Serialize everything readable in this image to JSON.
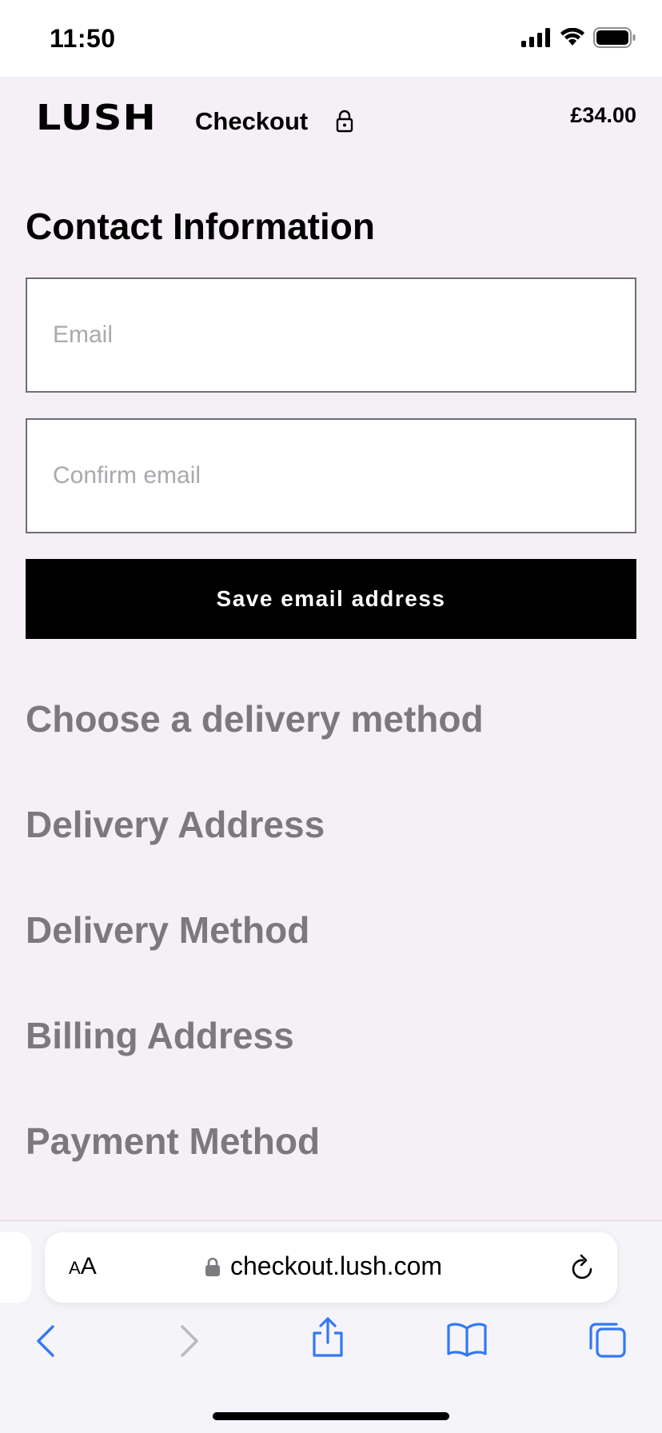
{
  "status_bar": {
    "time": "11:50",
    "icons": [
      "signal-icon",
      "wifi-icon",
      "battery-icon"
    ]
  },
  "header": {
    "logo": "LUSH",
    "title": "Checkout",
    "title_icon": "lock-icon",
    "total": "£34.00"
  },
  "contact": {
    "title": "Contact Information",
    "email_placeholder": "Email",
    "email_value": "",
    "confirm_placeholder": "Confirm email",
    "confirm_value": "",
    "save_label": "Save email address"
  },
  "steps": [
    {
      "label": "Choose a delivery method"
    },
    {
      "label": "Delivery Address"
    },
    {
      "label": "Delivery Method"
    },
    {
      "label": "Billing Address"
    },
    {
      "label": "Payment Method"
    }
  ],
  "browser": {
    "aa_small": "A",
    "aa_large": "A",
    "url": "checkout.lush.com",
    "toolbar": [
      "back-icon",
      "forward-icon",
      "share-icon",
      "bookmarks-icon",
      "tabs-icon"
    ],
    "accent": "#3478f6"
  },
  "colors": {
    "background": "#f4f0f6",
    "muted_heading": "#7b787e",
    "button": "#000000"
  }
}
